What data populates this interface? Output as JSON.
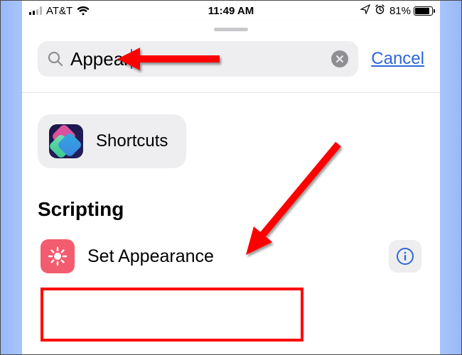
{
  "status": {
    "carrier": "AT&T",
    "time": "11:49 AM",
    "battery_pct": "81%"
  },
  "search": {
    "value": "Appear",
    "clear_icon": "clear-icon",
    "cancel": "Cancel"
  },
  "suggestion": {
    "app": "Shortcuts"
  },
  "section": {
    "title": "Scripting"
  },
  "action": {
    "label": "Set Appearance",
    "icon": "brightness-icon",
    "info": "info-icon"
  },
  "colors": {
    "accent": "#2f67d8",
    "annotation": "#ff0000",
    "action_icon_bg": "#f35c6e"
  }
}
